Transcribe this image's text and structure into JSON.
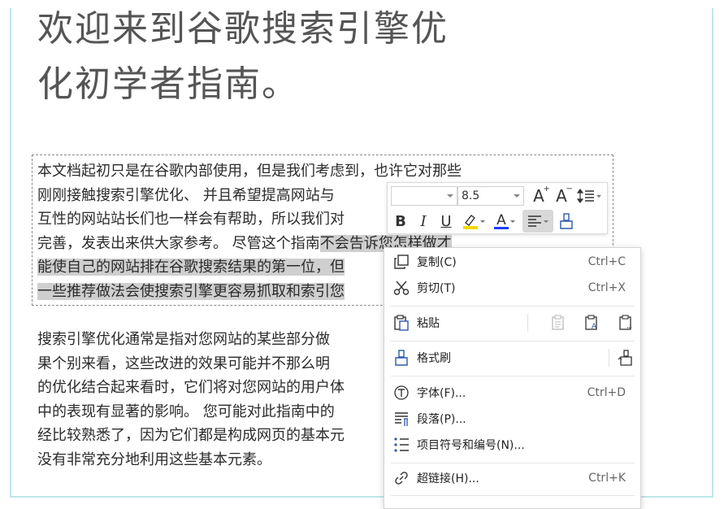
{
  "document": {
    "title": "欢迎来到谷歌搜索引擎优\n化初学者指南。",
    "paragraph1": {
      "lines": [
        {
          "plain": "本文档起初只是在谷歌内部使用，但是我们考虑到，也许它对那些",
          "highlight": ""
        },
        {
          "plain": "刚刚接触搜索引擎优化、  并且希望提高网站与",
          "highlight": ""
        },
        {
          "plain": "互性的网站站长们也一样会有帮助，所以我们对",
          "highlight": ""
        },
        {
          "plain": "完善，发表出来供大家参考。  尽管这个指南",
          "highlight": "不会告诉您怎样做才"
        },
        {
          "plain": "",
          "highlight": "能使自己的网站排在谷歌搜索结果的第一位，但"
        },
        {
          "plain": "",
          "highlight": "一些推荐做法会使搜索引擎更容易抓取和索引您"
        }
      ]
    },
    "paragraph2": {
      "lines": [
        "搜索引擎优化通常是指对您网站的某些部分做",
        "果个别来看，这些改进的效果可能并不那么明",
        "的优化结合起来看时，它们将对您网站的用户体",
        "中的表现有显著的影响。  您可能对此指南中的",
        "经比较熟悉了，因为它们都是构成网页的基本元",
        "没有非常充分地利用这些基本元素。"
      ]
    }
  },
  "mini_toolbar": {
    "font_name": "",
    "font_size": "8.5",
    "bold": "B",
    "italic": "I",
    "underline": "U",
    "font_color_letter": "A",
    "grow_font": "A",
    "shrink_font": "A",
    "colors": {
      "highlight": "#f5d800",
      "font_color": "#1a3cff"
    }
  },
  "context_menu": {
    "copy": {
      "label": "复制(C)",
      "shortcut": "Ctrl+C"
    },
    "cut": {
      "label": "剪切(T)",
      "shortcut": "Ctrl+X"
    },
    "paste": {
      "label": "粘贴"
    },
    "format_painter": {
      "label": "格式刷"
    },
    "font": {
      "label": "字体(F)...",
      "shortcut": "Ctrl+D"
    },
    "paragraph": {
      "label": "段落(P)..."
    },
    "bullets": {
      "label": "项目符号和编号(N)..."
    },
    "hyperlink": {
      "label": "超链接(H)...",
      "shortcut": "Ctrl+K"
    }
  },
  "icons": [
    "copy-icon",
    "cut-icon",
    "paste-icon",
    "paste-keep-text-icon",
    "paste-format-icon",
    "paste-special-icon",
    "format-painter-icon",
    "format-painter-quick-icon",
    "font-icon",
    "paragraph-icon",
    "bullet-list-icon",
    "hyperlink-icon",
    "grow-font-icon",
    "shrink-font-icon",
    "line-spacing-icon",
    "align-icon",
    "brush-icon"
  ]
}
